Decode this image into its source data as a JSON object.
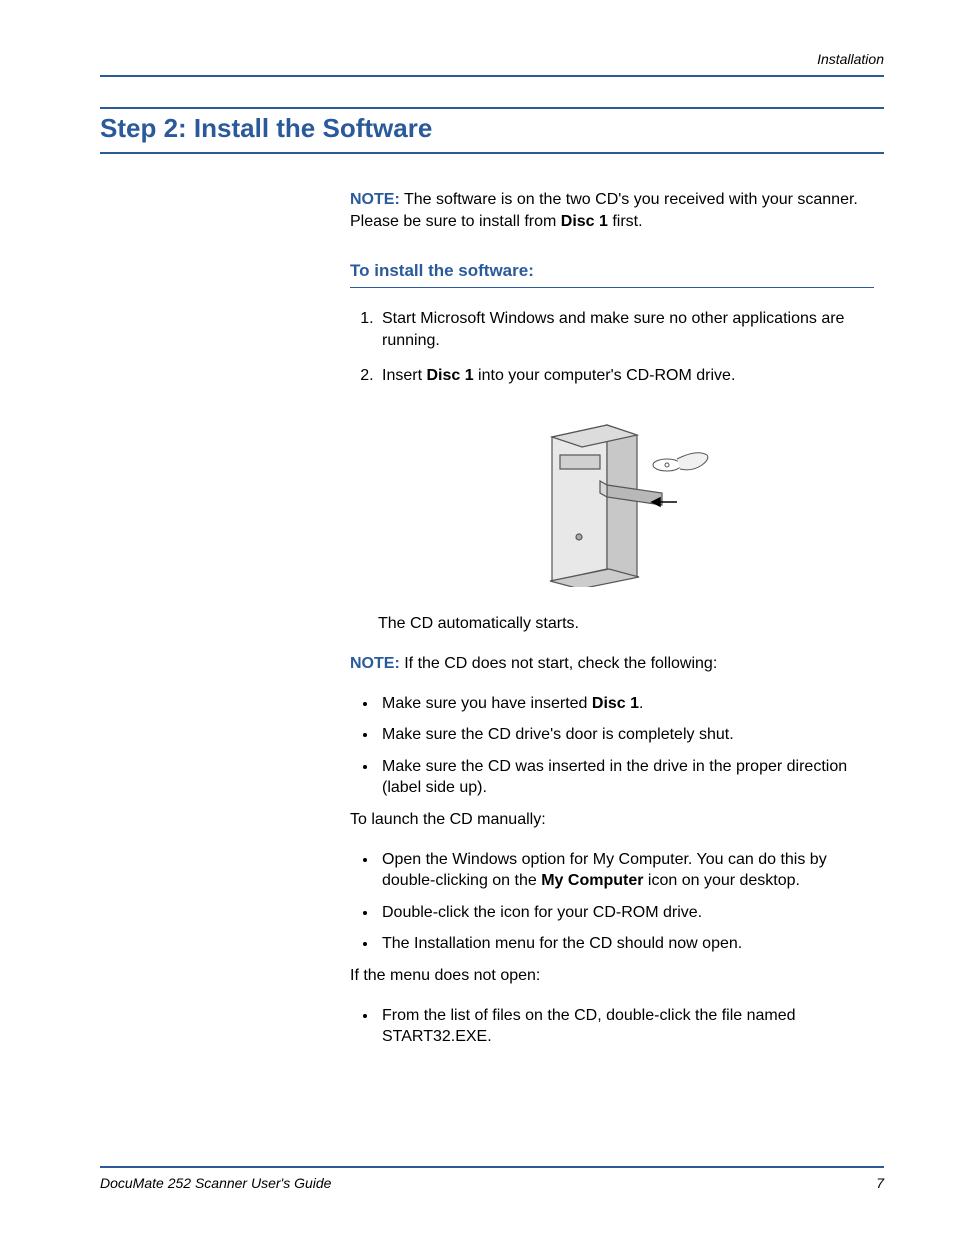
{
  "header": {
    "section": "Installation"
  },
  "title": "Step 2: Install the Software",
  "note1": {
    "label": "NOTE:",
    "pre": "  The software is on the two CD's you received with your scanner. Please be sure to install from ",
    "bold": "Disc 1",
    "post": " first."
  },
  "subhead": "To install the software:",
  "steps": {
    "s1": "Start Microsoft Windows and make sure no other applications are running.",
    "s2_pre": "Insert ",
    "s2_bold": "Disc 1",
    "s2_post": " into your computer's CD-ROM drive."
  },
  "afterFig": "The CD automatically starts.",
  "note2": {
    "label": "NOTE:",
    "text": "  If the CD does not start, check the following:"
  },
  "bullets1": {
    "b1_pre": "Make sure you have inserted ",
    "b1_bold": "Disc 1",
    "b1_post": ".",
    "b2": "Make sure the CD drive's door is completely shut.",
    "b3": "Make sure the CD was inserted in the drive in the proper direction (label side up)."
  },
  "launchManual": "To launch the CD manually:",
  "bullets2": {
    "b1_pre": "Open the Windows option for My Computer. You can do this by double-clicking on the ",
    "b1_bold": "My Computer",
    "b1_post": " icon on your desktop.",
    "b2": "Double-click the icon for your CD-ROM drive.",
    "b3": "The Installation menu for the CD should now open."
  },
  "ifNotOpen": "If the menu does not open:",
  "bullets3": {
    "b1": "From the list of files on the CD, double-click the file named START32.EXE."
  },
  "footer": {
    "title": "DocuMate 252 Scanner User's Guide",
    "page": "7"
  }
}
